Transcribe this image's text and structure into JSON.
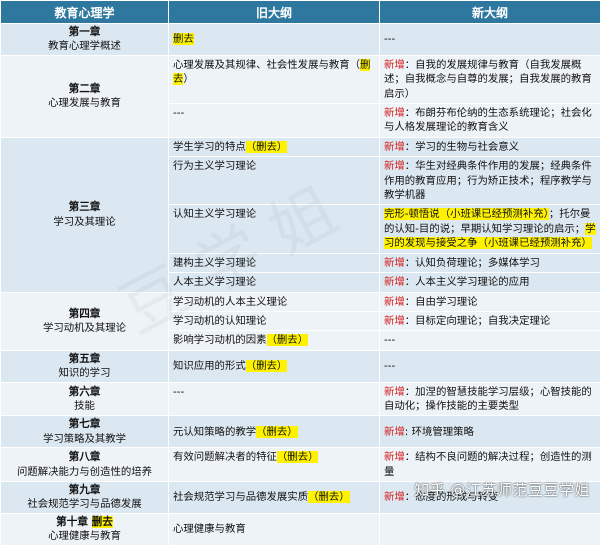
{
  "headers": [
    "教育心理学",
    "旧大纲",
    "新大纲"
  ],
  "del_label": "删去",
  "new_label": "新增",
  "ch1": {
    "num": "第一章",
    "title": "教育心理学概述",
    "old": "",
    "new": "---"
  },
  "ch2": {
    "num": "第二章",
    "title": "心理发展与教育",
    "old1": "心理发展及其规律、社会性发展与教育",
    "new1": "：自我的发展规律与教育（自我发展概述；自我概念与自尊的发展；自我发展的教育启示）",
    "old2": "---",
    "new2": "：布朗芬布伦纳的生态系统理论；社会化与人格发展理论的教育含义"
  },
  "ch3": {
    "num": "第三章",
    "title": "学习及其理论",
    "old1": "学生学习的特点",
    "new1": "：学习的生物与社会意义",
    "old2": "行为主义学习理论",
    "new2": "：华生对经典条件作用的发展；经典条件作用的教育应用；行为矫正技术；程序教学与教学机器",
    "old3": "认知主义学习理论",
    "new3a": "完形-顿悟说（小班课已经预测补充）",
    "new3b": "；托尔曼的认知-目的说；早期认知学习理论的启示；",
    "new3c": "学习的发现与接受之争（小班课已经预测补充）",
    "old4": "建构主义学习理论",
    "new4": "：认知负荷理论；多媒体学习",
    "old5": "人本主义学习理论",
    "new5": "：人本主义学习理论的应用"
  },
  "ch4": {
    "num": "第四章",
    "title": "学习动机及其理论",
    "old1": "学习动机的人本主义理论",
    "new1": "：自由学习理论",
    "old2": "学习动机的认知理论",
    "new2": "：目标定向理论；自我决定理论",
    "old3": "影响学习动机的因素",
    "new3": "---"
  },
  "ch5": {
    "num": "第五章",
    "title": "知识的学习",
    "old": "知识应用的形式",
    "new": "---"
  },
  "ch6": {
    "num": "第六章",
    "title": "技能",
    "old": "---",
    "new": "：加涅的智慧技能学习层级；心智技能的自动化；操作技能的主要类型"
  },
  "ch7": {
    "num": "第七章",
    "title": "学习策略及其教学",
    "old": "元认知策略的教学",
    "new": ": 环境管理策略"
  },
  "ch8": {
    "num": "第八章",
    "title": "问题解决能力与创造性的培养",
    "old": "有效问题解决者的特征",
    "new": "：结构不良问题的解决过程；创造性的测量"
  },
  "ch9": {
    "num": "第九章",
    "title": "社会规范学习与品德发展",
    "old": "社会规范学习与品德发展实质",
    "new": "：态度的形成与转变"
  },
  "ch10": {
    "num": "第十章",
    "title": "心理健康与教育",
    "old": "心理健康与教育"
  },
  "watermark": "知乎 @江苏师范豆豆学姐",
  "colors": {
    "header_bg": "#2e78a0",
    "row_a": "#dce8f1",
    "row_b": "#eef3f8",
    "highlight": "#fff200",
    "new_red": "#d42020"
  }
}
